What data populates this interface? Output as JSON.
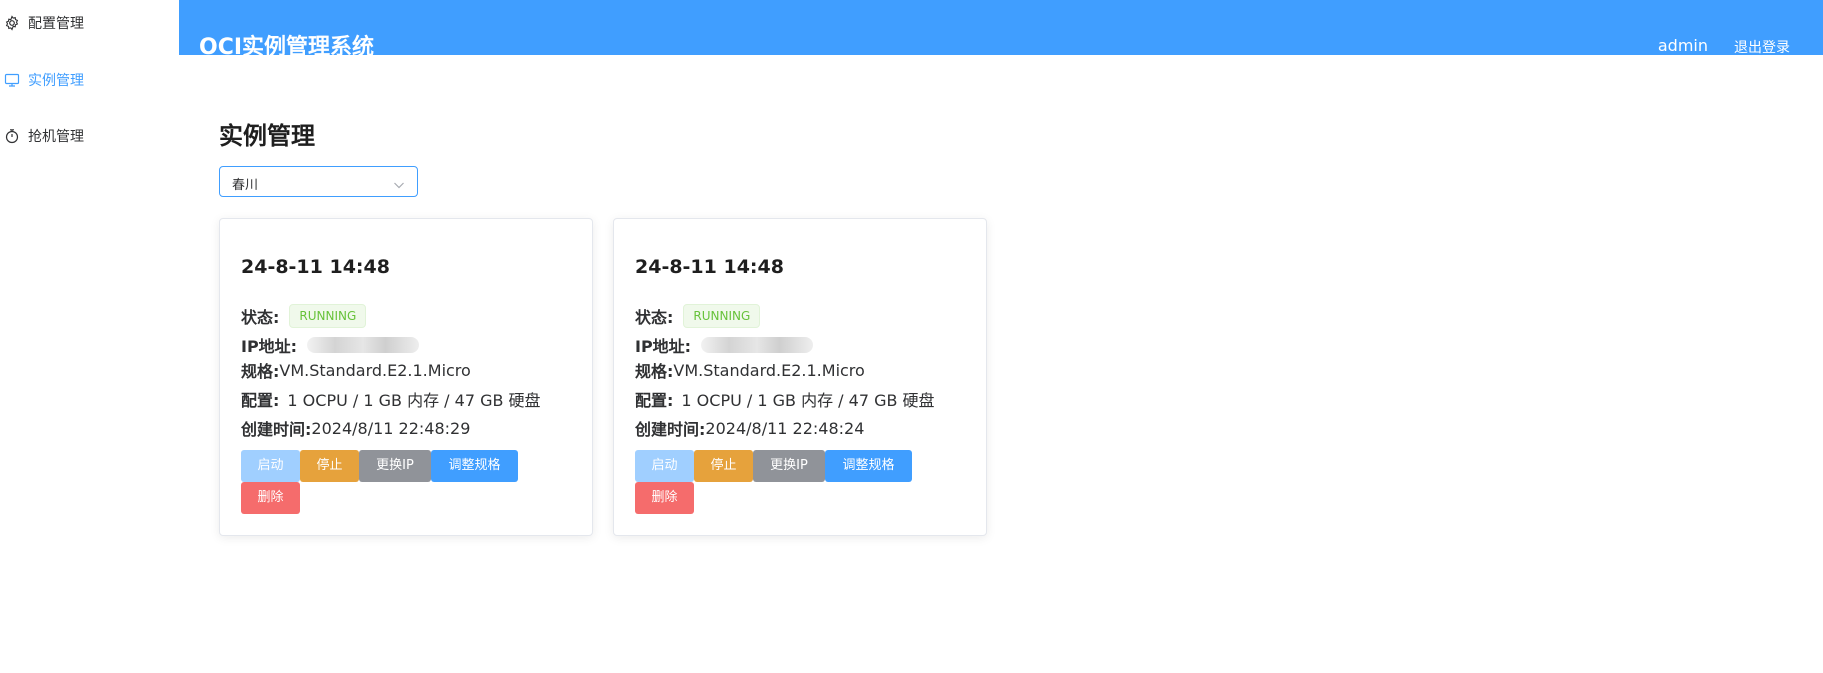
{
  "sidebar": {
    "items": [
      {
        "label": "配置管理",
        "icon": "gear-icon"
      },
      {
        "label": "实例管理",
        "icon": "monitor-icon",
        "active": true
      },
      {
        "label": "抢机管理",
        "icon": "timer-icon"
      }
    ]
  },
  "header": {
    "title": "OCI实例管理系统",
    "user": "admin",
    "logout": "退出登录"
  },
  "main": {
    "title": "实例管理",
    "region_select": {
      "value": "春川"
    },
    "labels": {
      "status": "状态:",
      "ip": "IP地址:",
      "shape": "规格:",
      "config": "配置:",
      "created": "创建时间:"
    },
    "buttons": {
      "start": "启动",
      "stop": "停止",
      "change_ip": "更换IP",
      "resize": "调整规格",
      "delete": "删除"
    },
    "instances": [
      {
        "name": "24-8-11 14:48",
        "status": "RUNNING",
        "shape": "VM.Standard.E2.1.Micro",
        "config": "1 OCPU / 1 GB 内存 / 47 GB 硬盘",
        "created": "2024/8/11 22:48:29"
      },
      {
        "name": "24-8-11 14:48",
        "status": "RUNNING",
        "shape": "VM.Standard.E2.1.Micro",
        "config": "1 OCPU / 1 GB 内存 / 47 GB 硬盘",
        "created": "2024/8/11 22:48:24"
      }
    ]
  },
  "colors": {
    "primary": "#409eff",
    "success": "#67c23a",
    "warning": "#e6a23c",
    "info": "#909399",
    "danger": "#f56c6c"
  }
}
